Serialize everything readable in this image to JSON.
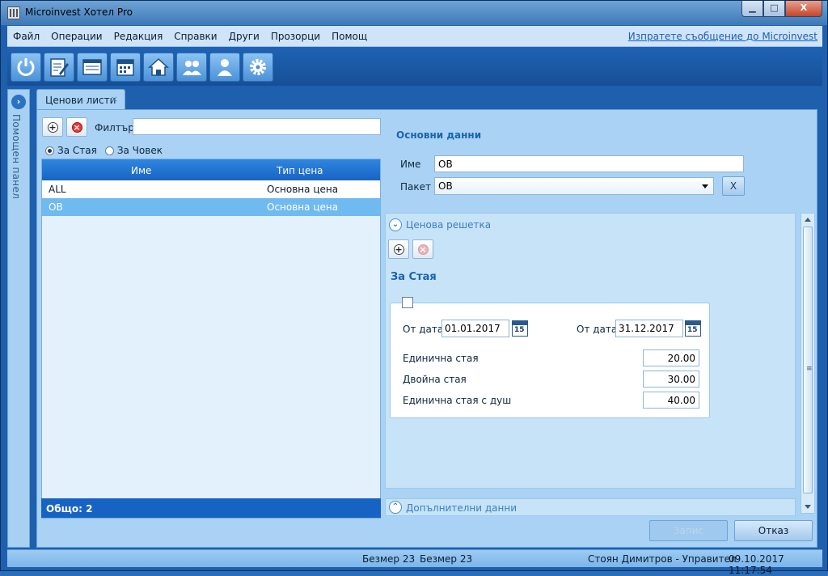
{
  "window": {
    "title": "Microinvest Хотел Pro",
    "min": "▁",
    "max": "□",
    "close": "X"
  },
  "menu": {
    "items": [
      "Файл",
      "Операции",
      "Редакция",
      "Справки",
      "Други",
      "Прозорци",
      "Помощ"
    ],
    "link": "Изпратете съобщение до Microinvest"
  },
  "toolbar": {
    "icons": [
      "power-icon",
      "edit-document-icon",
      "report-icon",
      "calendar-icon",
      "home-icon",
      "users-icon",
      "user-icon",
      "settings-gear-icon"
    ]
  },
  "side_panel": {
    "label": "Помощен панел",
    "arrow": "›"
  },
  "tab": {
    "label": "Ценови листи",
    "close": "⨯"
  },
  "list": {
    "filter_label": "Филтър",
    "filter_value": "",
    "radio_room": "За Стая",
    "radio_person": "За Човек",
    "radio_selected": "room",
    "col_name": "Име",
    "col_type": "Тип цена",
    "rows": [
      {
        "name": "ALL",
        "type": "Основна цена"
      },
      {
        "name": "OB",
        "type": "Основна цена"
      }
    ],
    "selected_row": 1,
    "footer": "Общо: 2"
  },
  "details": {
    "section_title": "Основни данни",
    "name_label": "Име",
    "name_value": "OB",
    "package_label": "Пакет",
    "package_value": "OB",
    "clear_button": "X"
  },
  "price_grid": {
    "expander_label": "Ценова решетка",
    "expander_glyph": "⌄",
    "group_title": "За Стая",
    "from_label": "От дата",
    "from_value": "01.01.2017",
    "to_label": "От дата",
    "to_value": "31.12.2017",
    "calendar_day": "15",
    "rows": [
      {
        "label": "Единична стая",
        "value": "20.00"
      },
      {
        "label": "Двойна стая",
        "value": "30.00"
      },
      {
        "label": "Единична стая с душ",
        "value": "40.00"
      }
    ]
  },
  "additional": {
    "label": "Допълнителни данни",
    "glyph": "⌃"
  },
  "buttons": {
    "save": "Запис",
    "cancel": "Отказ"
  },
  "status": {
    "left": "Безмер 23",
    "middle": "Безмер 23",
    "user": "Стоян Димитров - Управител",
    "datetime": "09.10.2017 11:17:54"
  },
  "glyphs": {
    "plus": "+",
    "cross": "×",
    "grip": "≡"
  }
}
